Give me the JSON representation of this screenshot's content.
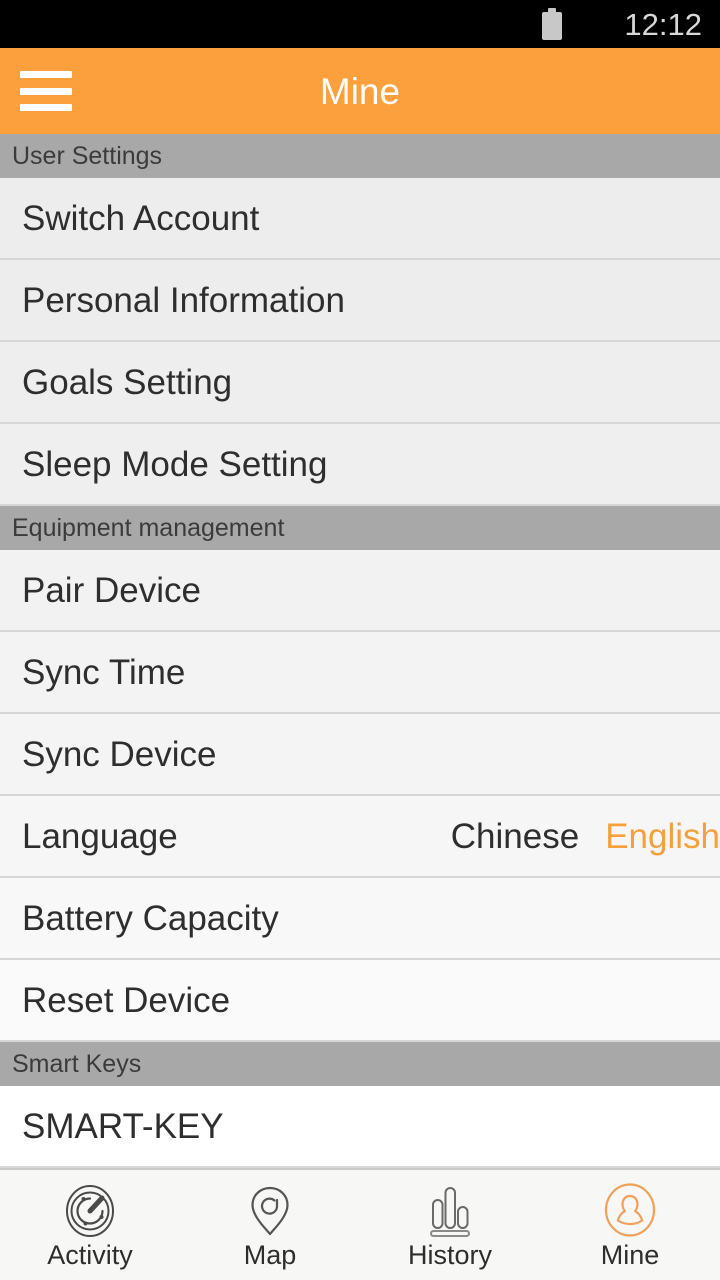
{
  "status_bar": {
    "battery_icon": "battery-icon",
    "time": "12:12"
  },
  "app_bar": {
    "menu_icon": "hamburger-menu-icon",
    "title": "Mine"
  },
  "colors": {
    "accent_orange": "#fba03c",
    "selected_orange": "#f5a03c",
    "section_header_gray": "#a8a8a8",
    "status_bar_black": "#000000",
    "row_text": "#2e2e2e"
  },
  "sections": [
    {
      "header": "User Settings",
      "rows": [
        {
          "label": "Switch Account"
        },
        {
          "label": "Personal Information"
        },
        {
          "label": "Goals Setting"
        },
        {
          "label": "Sleep Mode Setting"
        }
      ]
    },
    {
      "header": "Equipment management",
      "rows": [
        {
          "label": "Pair Device"
        },
        {
          "label": "Sync Time"
        },
        {
          "label": "Sync Device"
        },
        {
          "label": "Language",
          "options": [
            {
              "text": "Chinese",
              "selected": false
            },
            {
              "text": "English",
              "selected": true
            }
          ]
        },
        {
          "label": "Battery Capacity"
        },
        {
          "label": "Reset Device"
        }
      ]
    },
    {
      "header": "Smart Keys",
      "rows": [
        {
          "label": "SMART-KEY"
        }
      ]
    }
  ],
  "bottom_nav": {
    "items": [
      {
        "label": "Activity",
        "icon": "radar-target-icon",
        "active": false
      },
      {
        "label": "Map",
        "icon": "location-pin-icon",
        "active": false
      },
      {
        "label": "History",
        "icon": "bar-chart-icon",
        "active": false
      },
      {
        "label": "Mine",
        "icon": "user-circle-icon",
        "active": true
      }
    ]
  }
}
